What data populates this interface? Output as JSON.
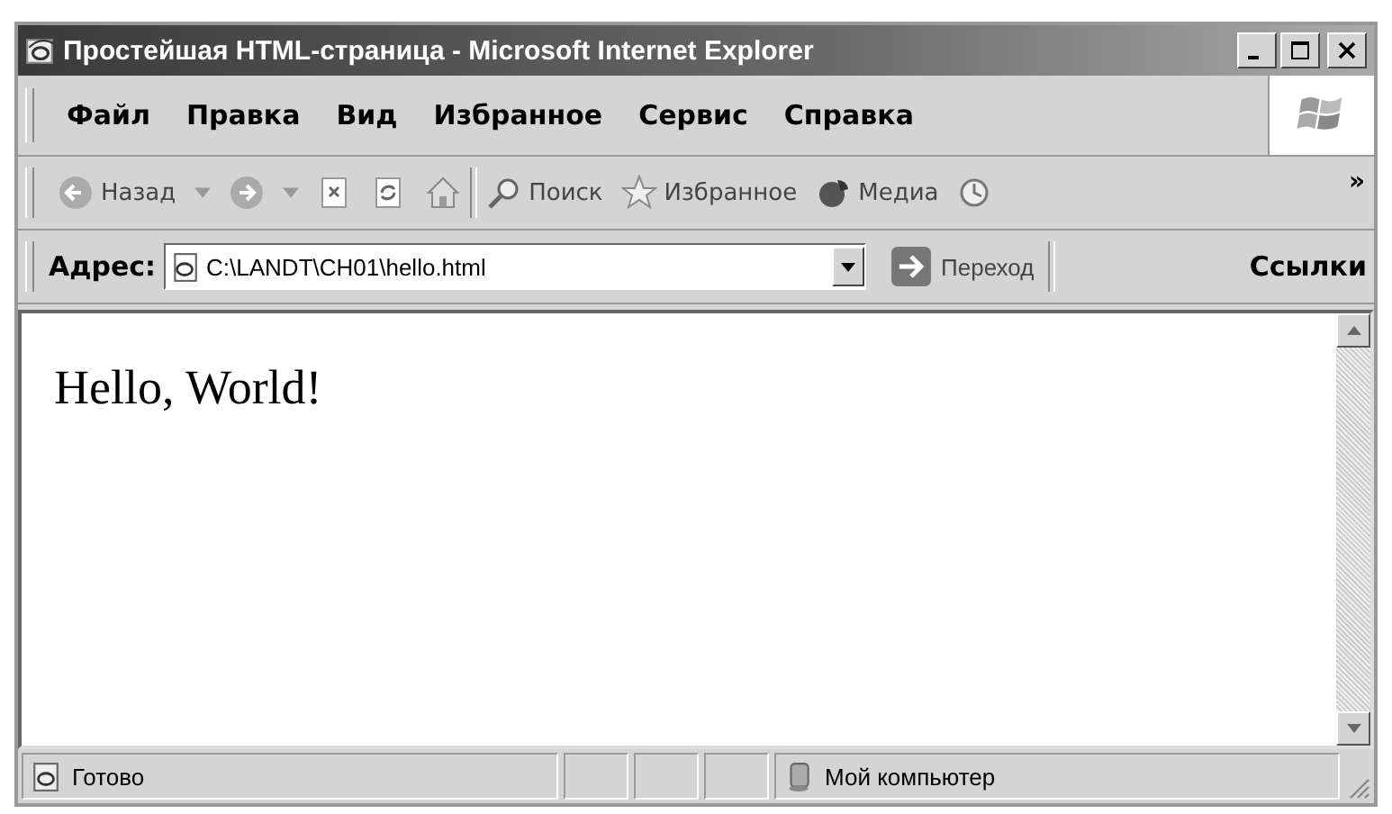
{
  "window": {
    "title": "Простейшая HTML-страница - Microsoft Internet Explorer"
  },
  "menu": [
    "Файл",
    "Правка",
    "Вид",
    "Избранное",
    "Сервис",
    "Справка"
  ],
  "toolbar": [
    {
      "kind": "back",
      "label": "Назад"
    },
    {
      "kind": "forward"
    },
    {
      "kind": "stop"
    },
    {
      "kind": "refresh"
    },
    {
      "kind": "home"
    },
    {
      "kind": "search",
      "label": "Поиск"
    },
    {
      "kind": "favorites",
      "label": "Избранное"
    },
    {
      "kind": "media",
      "label": "Медиа"
    },
    {
      "kind": "history"
    },
    {
      "kind": "more",
      "label": "»"
    }
  ],
  "address": {
    "label": "Адрес:",
    "value": "C:\\LANDT\\CH01\\hello.html",
    "go": "Переход",
    "links": "Ссылки"
  },
  "content": {
    "text": "Hello, World!"
  },
  "status_bar": {
    "text": "Готово",
    "zone": "Мой компьютер"
  }
}
